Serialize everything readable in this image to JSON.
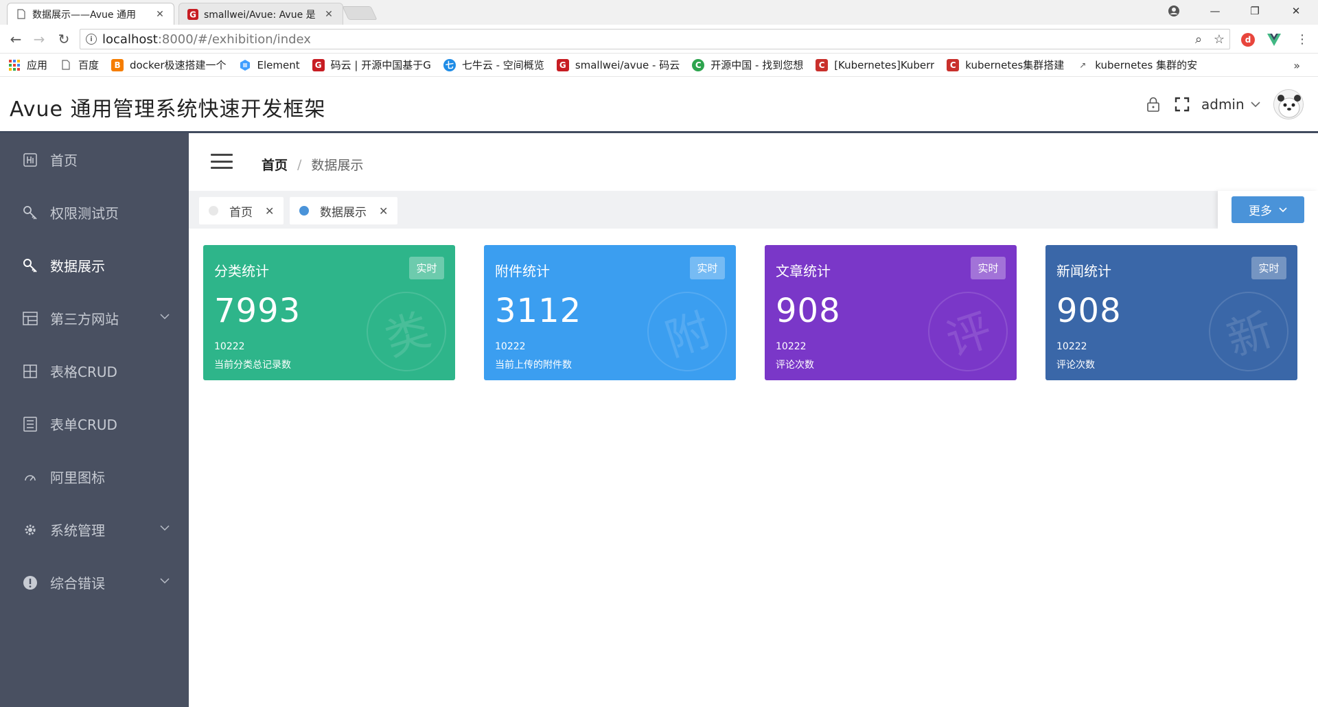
{
  "browser": {
    "tabs": [
      {
        "title": "数据展示——Avue 通用",
        "active": true
      },
      {
        "title": "smallwei/Avue: Avue 是",
        "active": false
      }
    ],
    "address": {
      "url_host": "localhost",
      "url_rest": ":8000/#/exhibition/index"
    },
    "bookmarks": [
      {
        "label": "应用",
        "icon": "apps-grid-icon"
      },
      {
        "label": "百度",
        "icon": "page-icon"
      },
      {
        "label": "docker极速搭建一个",
        "icon": "blogger-icon"
      },
      {
        "label": "Element",
        "icon": "element-icon"
      },
      {
        "label": "码云 | 开源中国基于G",
        "icon": "gitee-icon"
      },
      {
        "label": "七牛云 - 空间概览",
        "icon": "qiniu-icon"
      },
      {
        "label": "smallwei/avue - 码云",
        "icon": "gitee-icon"
      },
      {
        "label": "开源中国 - 找到您想",
        "icon": "oschina-icon"
      },
      {
        "label": "[Kubernetes]Kuberr",
        "icon": "csdn-icon"
      },
      {
        "label": "kubernetes集群搭建",
        "icon": "csdn-icon"
      },
      {
        "label": "kubernetes 集群的安",
        "icon": "link-icon"
      }
    ],
    "more_bookmarks": "»"
  },
  "header": {
    "title": "Avue 通用管理系统快速开发框架",
    "username": "admin"
  },
  "sidebar": {
    "items": [
      {
        "label": "首页",
        "icon": "home-icon",
        "active": false,
        "has_children": false
      },
      {
        "label": "权限测试页",
        "icon": "key-icon",
        "active": false,
        "has_children": false
      },
      {
        "label": "数据展示",
        "icon": "key-icon",
        "active": true,
        "has_children": false
      },
      {
        "label": "第三方网站",
        "icon": "layout-icon",
        "active": false,
        "has_children": true
      },
      {
        "label": "表格CRUD",
        "icon": "table-icon",
        "active": false,
        "has_children": false
      },
      {
        "label": "表单CRUD",
        "icon": "form-icon",
        "active": false,
        "has_children": false
      },
      {
        "label": "阿里图标",
        "icon": "speed-icon",
        "active": false,
        "has_children": false
      },
      {
        "label": "系统管理",
        "icon": "gear-icon",
        "active": false,
        "has_children": true
      },
      {
        "label": "综合错误",
        "icon": "alert-icon",
        "active": false,
        "has_children": true
      }
    ]
  },
  "breadcrumb": {
    "root": "首页",
    "separator": "/",
    "current": "数据展示"
  },
  "tags": [
    {
      "label": "首页",
      "active": false
    },
    {
      "label": "数据展示",
      "active": true
    }
  ],
  "more_button": "更多",
  "cards": [
    {
      "title": "分类统计",
      "badge": "实时",
      "value": "7993",
      "sub": "10222",
      "desc": "当前分类总记录数",
      "watermark": "类",
      "color": "#2eb58a"
    },
    {
      "title": "附件统计",
      "badge": "实时",
      "value": "3112",
      "sub": "10222",
      "desc": "当前上传的附件数",
      "watermark": "附",
      "color": "#3b9ef0"
    },
    {
      "title": "文章统计",
      "badge": "实时",
      "value": "908",
      "sub": "10222",
      "desc": "评论次数",
      "watermark": "评",
      "color": "#7a37c8"
    },
    {
      "title": "新闻统计",
      "badge": "实时",
      "value": "908",
      "sub": "10222",
      "desc": "评论次数",
      "watermark": "新",
      "color": "#3a67a8"
    }
  ]
}
